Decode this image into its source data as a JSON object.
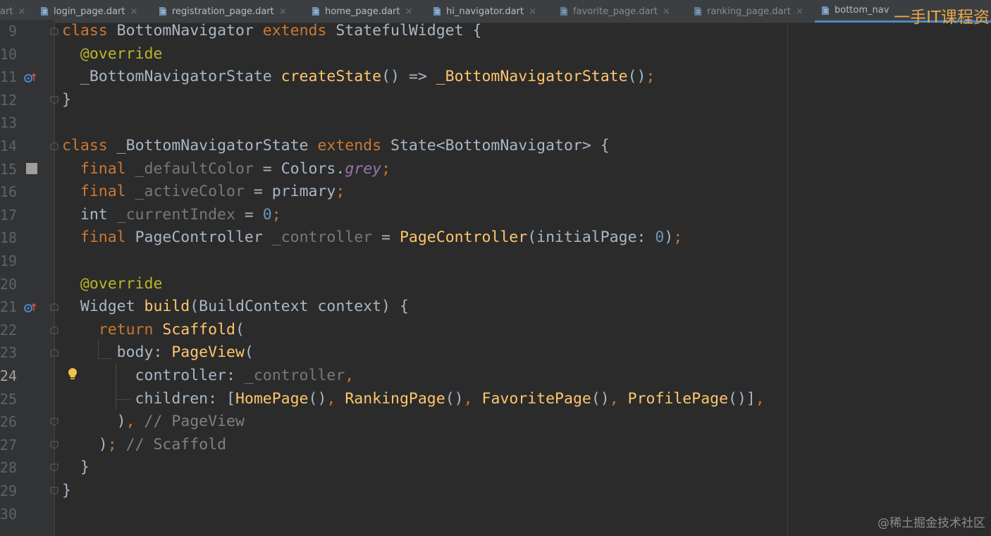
{
  "tabs": [
    {
      "label": "art",
      "state": "partial"
    },
    {
      "label": "login_page.dart"
    },
    {
      "label": "registration_page.dart"
    },
    {
      "label": "home_page.dart"
    },
    {
      "label": "hi_navigator.dart"
    },
    {
      "label": "favorite_page.dart"
    },
    {
      "label": "ranking_page.dart"
    },
    {
      "label": "bottom_nav",
      "state": "active"
    }
  ],
  "watermark_top": "一手IT课程资",
  "watermark_bottom": "@稀土掘金技术社区",
  "editor": {
    "current_line": 24,
    "line_numbers": [
      "9",
      "10",
      "11",
      "12",
      "13",
      "14",
      "15",
      "16",
      "17",
      "18",
      "19",
      "20",
      "21",
      "22",
      "23",
      "24",
      "25",
      "26",
      "27",
      "28",
      "29",
      "30"
    ],
    "gutter_icons": [
      {
        "line": 11,
        "icon": "override-method-icon"
      },
      {
        "line": 15,
        "icon": "color-swatch-icon",
        "color": "#9e9e9e"
      },
      {
        "line": 21,
        "icon": "override-method-icon"
      },
      {
        "line": 24,
        "icon": "lightbulb-icon",
        "color": "#f2c14e"
      }
    ]
  },
  "colors": {
    "background": "#2b2b2b",
    "keyword": "#cc7832",
    "function": "#ffc66d",
    "annotation": "#bbb529",
    "number": "#6897bb",
    "field": "#787878",
    "static_field": "#9876aa",
    "comment": "#808080",
    "text": "#a9b7c6"
  }
}
